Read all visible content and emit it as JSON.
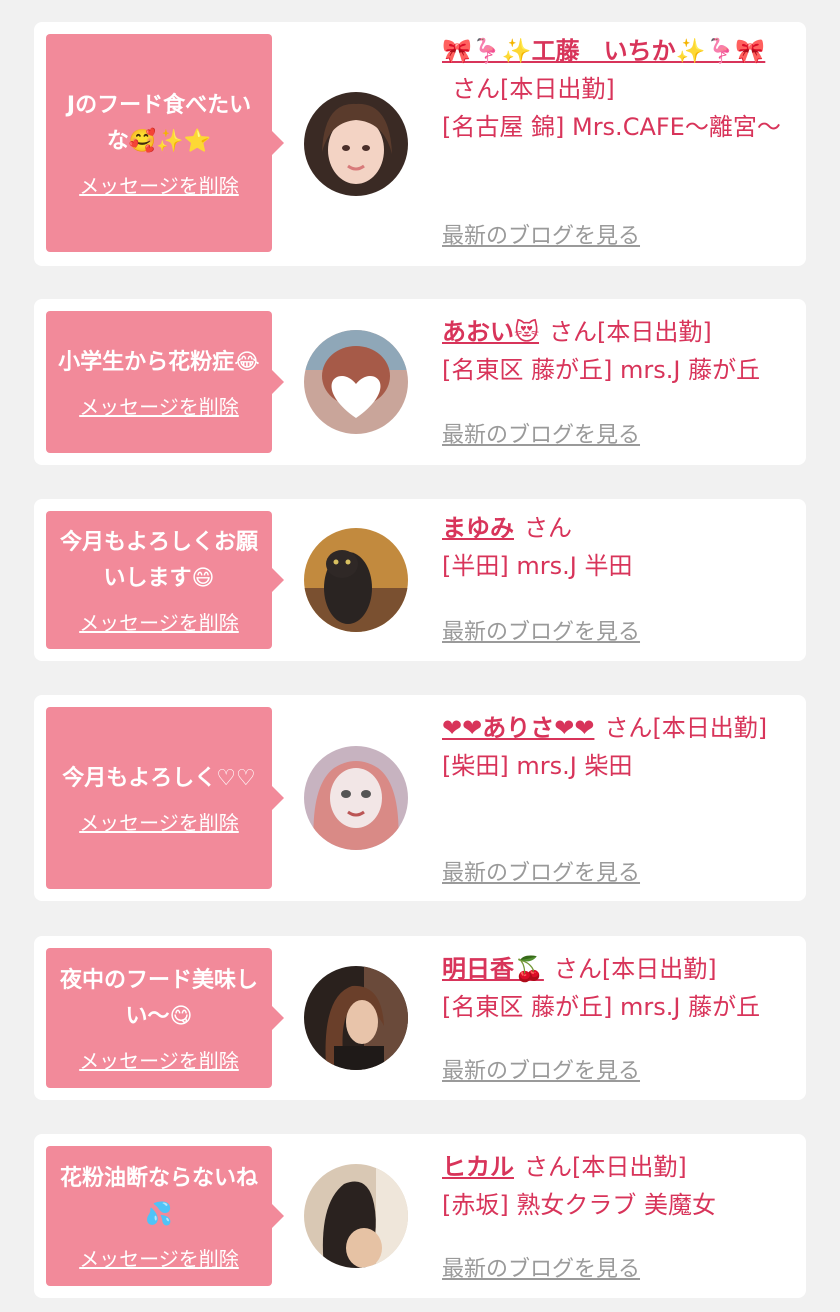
{
  "delete_label": "メッセージを削除",
  "blog_label": "最新のブログを見る",
  "san_label": "さん",
  "status_label": "[本日出勤]",
  "colors": {
    "bubble": "#f28a9a",
    "accent": "#d8345a",
    "muted": "#9a9a9a",
    "background": "#f1f1f1"
  },
  "cards": [
    {
      "message": "Jのフード食べたいな🥰✨⭐",
      "name": "🎀🦩✨工藤　いちか✨🦩🎀",
      "area": "[名古屋 錦] Mrs.CAFE～離宮～",
      "avatar": "avatar-photo-woman"
    },
    {
      "message": "小学生から花粉症😂",
      "name": "あおい😻",
      "area": "[名東区 藤が丘] mrs.J 藤が丘",
      "avatar": "avatar-photo-heart-blur"
    },
    {
      "message": "今月もよろしくお願いします😄",
      "name": "まゆみ",
      "area": "[半田] mrs.J 半田",
      "avatar": "avatar-photo-cat"
    },
    {
      "message": "今月もよろしく♡♡",
      "name": "❤❤ありさ❤❤",
      "area": "[柴田] mrs.J 柴田",
      "avatar": "avatar-photo-face-mask"
    },
    {
      "message": "夜中のフード美味しい～😋",
      "name": "明日香🍒",
      "area": "[名東区 藤が丘] mrs.J 藤が丘",
      "avatar": "avatar-photo-woman-dark"
    },
    {
      "message": "花粉油断ならないね💦",
      "name": "ヒカル",
      "area": "[赤坂] 熟女クラブ 美魔女",
      "avatar": "avatar-photo-back"
    }
  ]
}
